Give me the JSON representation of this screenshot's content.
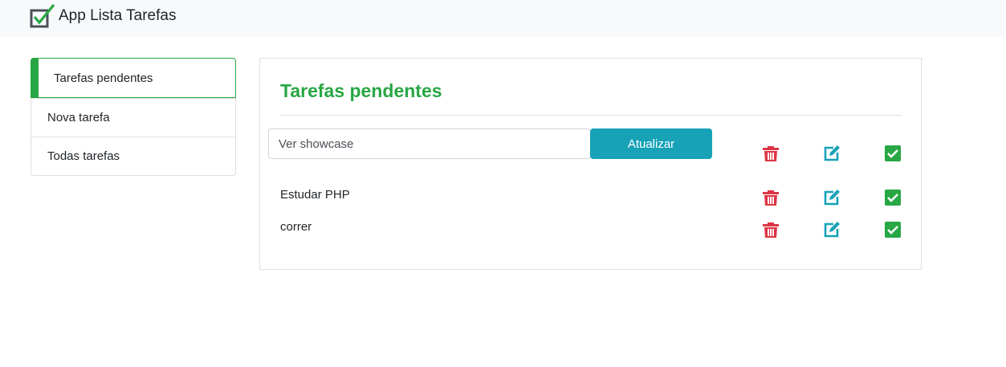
{
  "app": {
    "title": "App Lista Tarefas",
    "logo_icon": "checkbox-logo-icon"
  },
  "sidebar": {
    "items": [
      {
        "label": "Tarefas pendentes",
        "active": true
      },
      {
        "label": "Nova tarefa",
        "active": false
      },
      {
        "label": "Todas tarefas",
        "active": false
      }
    ]
  },
  "main": {
    "title": "Tarefas pendentes",
    "edit_row": {
      "input_value": "Ver showcase",
      "button_label": "Atualizar"
    },
    "tasks": [
      {
        "text": "Estudar PHP"
      },
      {
        "text": "correr"
      }
    ]
  },
  "icons": {
    "delete": "trash-icon",
    "edit": "edit-icon",
    "complete": "check-square-icon"
  },
  "colors": {
    "primary_green": "#28a745",
    "info": "#17a2b8",
    "danger": "#dc3545",
    "navbar_bg": "#f8f9fa"
  }
}
